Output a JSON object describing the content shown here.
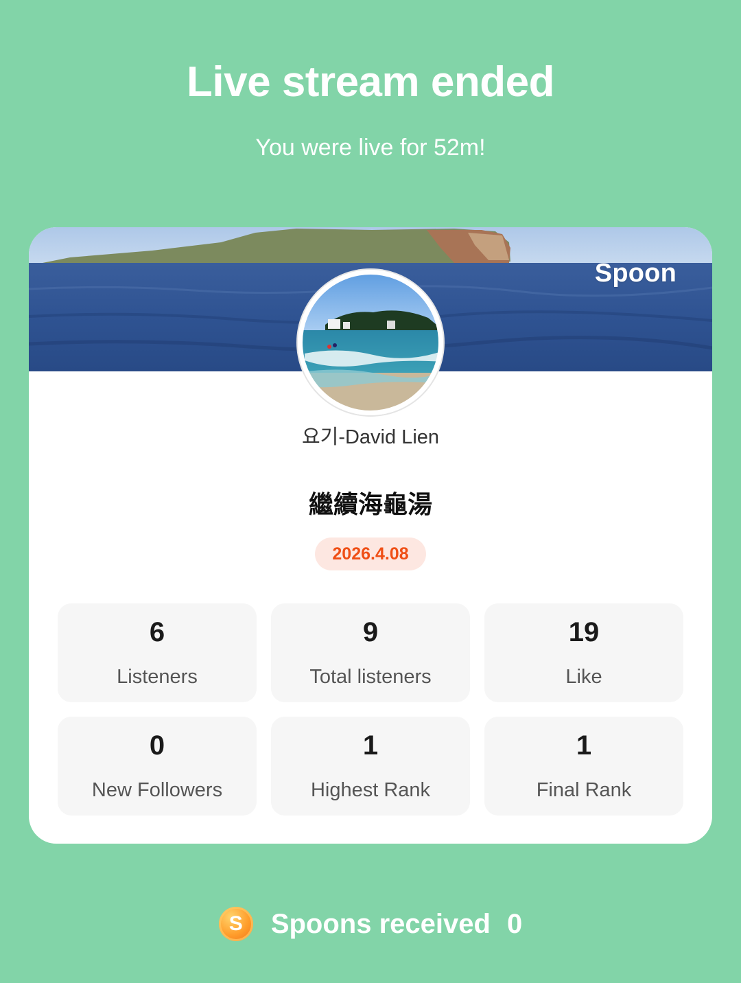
{
  "header": {
    "title": "Live stream ended",
    "subtitle": "You were live for 52m!"
  },
  "card": {
    "brand": "Spoon",
    "username": "요기-David Lien",
    "stream_title": "繼續海龜湯",
    "date": "2026.4.08",
    "stats": [
      {
        "value": "6",
        "label": "Listeners"
      },
      {
        "value": "9",
        "label": "Total listeners"
      },
      {
        "value": "19",
        "label": "Like"
      },
      {
        "value": "0",
        "label": "New Followers"
      },
      {
        "value": "1",
        "label": "Highest Rank"
      },
      {
        "value": "1",
        "label": "Final Rank"
      }
    ]
  },
  "footer": {
    "spoons_icon_letter": "S",
    "spoons_label": "Spoons received",
    "spoons_count": "0"
  },
  "colors": {
    "background": "#82d4a8",
    "date_text": "#ef4f16",
    "date_badge": "#fde7e1"
  }
}
